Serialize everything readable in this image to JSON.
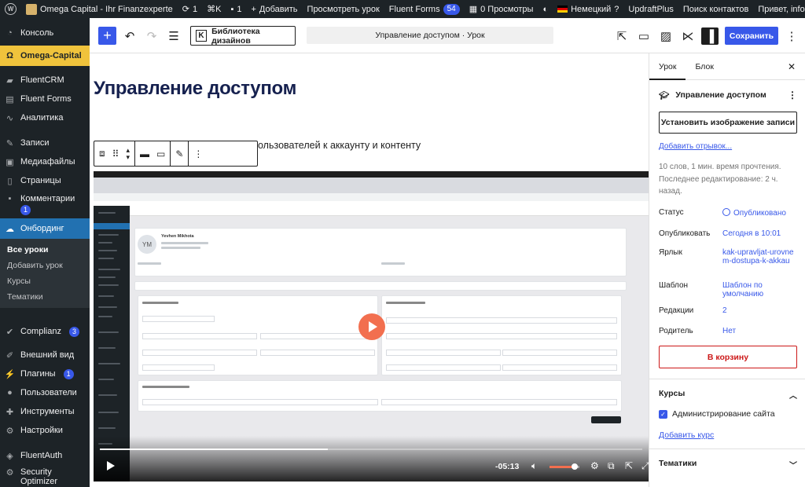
{
  "adminbar": {
    "site_name": "Omega Capital - Ihr Finanzexperte",
    "updates_count": "1",
    "shortcut": "⌘K",
    "comments_count": "1",
    "add_new": "Добавить",
    "view_lesson": "Просмотреть урок",
    "fluent_forms": "Fluent Forms",
    "fluent_forms_count": "54",
    "views": "0 Просмотры",
    "language": "Немецкий",
    "help": "?",
    "updraft": "UpdraftPlus",
    "search_contacts": "Поиск контактов",
    "greeting": "Привет, info"
  },
  "sidebar": {
    "items": [
      {
        "label": "Консоль",
        "icon": "dashboard-icon"
      },
      {
        "label": "Omega-Capital",
        "icon": "omega-icon"
      },
      {
        "label": "FluentCRM",
        "icon": "fluentcrm-icon"
      },
      {
        "label": "Fluent Forms",
        "icon": "forms-icon"
      },
      {
        "label": "Аналитика",
        "icon": "analytics-icon"
      },
      {
        "label": "Записи",
        "icon": "pin-icon"
      },
      {
        "label": "Медиафайлы",
        "icon": "media-icon"
      },
      {
        "label": "Страницы",
        "icon": "pages-icon"
      },
      {
        "label": "Комментарии",
        "icon": "comments-icon",
        "badge": "1"
      },
      {
        "label": "Онбординг",
        "icon": "onboarding-icon"
      },
      {
        "label": "Complianz",
        "icon": "complianz-icon",
        "badge": "3"
      },
      {
        "label": "Внешний вид",
        "icon": "appearance-icon"
      },
      {
        "label": "Плагины",
        "icon": "plugins-icon",
        "badge": "1"
      },
      {
        "label": "Пользователи",
        "icon": "users-icon"
      },
      {
        "label": "Инструменты",
        "icon": "tools-icon"
      },
      {
        "label": "Настройки",
        "icon": "settings-icon"
      },
      {
        "label": "FluentAuth",
        "icon": "fluentauth-icon"
      },
      {
        "label": "Security Optimizer",
        "icon": "security-icon"
      }
    ],
    "submenu": [
      "Все уроки",
      "Добавить урок",
      "Курсы",
      "Тематики"
    ]
  },
  "toolbar": {
    "add": "+",
    "library": "Библиотека дизайнов",
    "document_title": "Управление доступом · Урок",
    "save": "Сохранить"
  },
  "editor": {
    "title": "Управление доступом",
    "paragraph": "ользователей к аккаунту и контенту"
  },
  "video": {
    "time": "-05:13",
    "progress": 0.42,
    "volume": 0.85,
    "contact_name": "Yevhen Mikhota",
    "avatar_initials": "YM"
  },
  "panel": {
    "tab_lesson": "Урок",
    "tab_block": "Блок",
    "heading": "Управление доступом",
    "featured_image": "Установить изображение записи",
    "excerpt": "Добавить отрывок...",
    "meta_words": "10 слов, 1 мин. время прочтения.",
    "meta_edited": "Последнее редактирование: 2 ч. назад.",
    "rows": {
      "status": {
        "k": "Статус",
        "v": "Опубликовано"
      },
      "publish": {
        "k": "Опубликовать",
        "v": "Сегодня в 10:01"
      },
      "slug": {
        "k": "Ярлык",
        "v": "kak-upravljat-urovnem-dostupa-k-akkau"
      },
      "template": {
        "k": "Шаблон",
        "v": "Шаблон по умолчанию"
      },
      "revisions": {
        "k": "Редакции",
        "v": "2"
      },
      "parent": {
        "k": "Родитель",
        "v": "Нет"
      }
    },
    "trash": "В корзину",
    "courses_title": "Курсы",
    "course_checked": "Администрирование сайта",
    "add_course": "Добавить курс",
    "topics_title": "Тематики"
  }
}
